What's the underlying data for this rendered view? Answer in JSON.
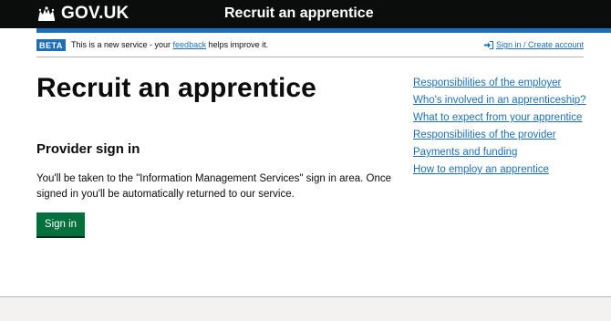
{
  "header": {
    "logo_text": "GOV.UK",
    "service_name": "Recruit an apprentice"
  },
  "phase_banner": {
    "tag": "BETA",
    "text_before": "This is a new service - your ",
    "feedback_link": "feedback",
    "text_after": " helps improve it.",
    "account_link": "Sign in / Create account"
  },
  "main": {
    "title": "Recruit an apprentice",
    "section_title": "Provider sign in",
    "body": "You'll be taken to the \"Information Management Services\" sign in area. Once signed in you'll be automatically returned to our service.",
    "button_label": "Sign in"
  },
  "related_links": [
    "Responsibilities of the employer",
    "Who's involved in an apprenticeship?",
    "What to expect from your apprentice",
    "Responsibilities of the provider",
    "Payments and funding",
    "How to employ an apprentice"
  ],
  "colors": {
    "header_bg": "#0b0c0c",
    "accent_blue": "#1d70b8",
    "button_green": "#00703c"
  }
}
